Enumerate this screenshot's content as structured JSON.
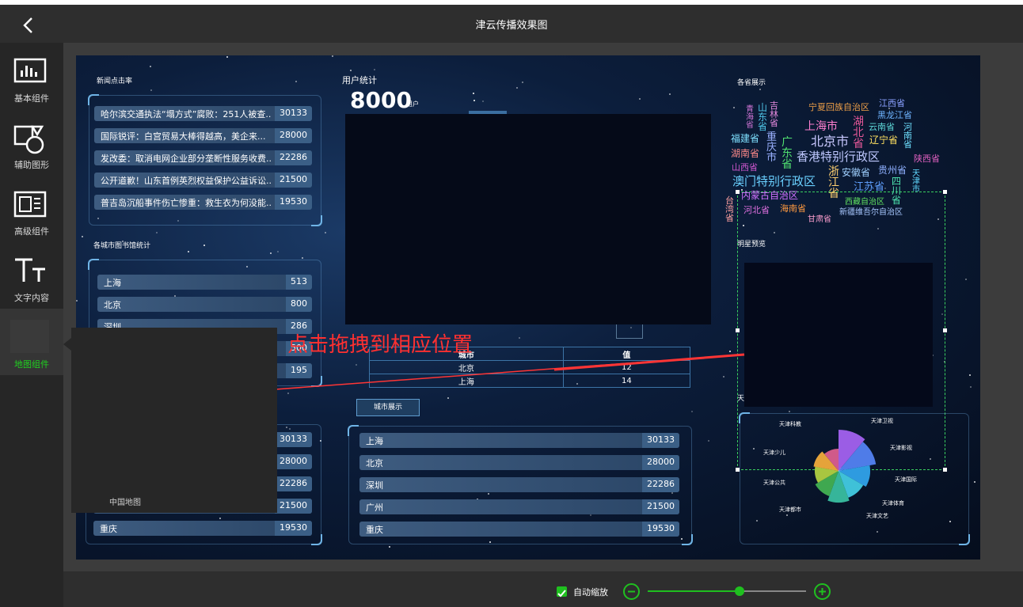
{
  "app": {
    "title": "津云传播效果图"
  },
  "sidebar": {
    "items": [
      {
        "label": "基本组件",
        "icon": "bar-chart-icon"
      },
      {
        "label": "辅助图形",
        "icon": "shapes-icon"
      },
      {
        "label": "高级组件",
        "icon": "layout-icon"
      },
      {
        "label": "文字内容",
        "icon": "text-icon"
      },
      {
        "label": "地图组件",
        "icon": "map-icon"
      }
    ]
  },
  "flyout": {
    "item_label": "中国地图"
  },
  "hint": {
    "text": "点击拖拽到相应位置"
  },
  "bottom": {
    "auto_zoom_label": "自动缩放",
    "zoom_level": 0.58
  },
  "canvas": {
    "news": {
      "title": "新闻点击率",
      "items": [
        {
          "name": "哈尔滨交通执法“塌方式”腐败：251人被查...",
          "value": "30133"
        },
        {
          "name": "国际锐评：白宫贸易大棒得越高，美企来...",
          "value": "28000"
        },
        {
          "name": "发改委：取消电网企业部分垄断性服务收费...",
          "value": "22286"
        },
        {
          "name": "公开道歉！山东首例英烈权益保护公益诉讼...",
          "value": "21500"
        },
        {
          "name": "普吉岛沉船事件伤亡惨重：救生衣为何没能...",
          "value": "19530"
        }
      ]
    },
    "library": {
      "title": "各城市图书馆统计",
      "items": [
        {
          "name": "上海",
          "value": "513"
        },
        {
          "name": "北京",
          "value": "800"
        },
        {
          "name": "深圳",
          "value": "286"
        },
        {
          "name": "",
          "value": "500"
        },
        {
          "name": "",
          "value": "195"
        }
      ]
    },
    "bottom_left": {
      "items": [
        {
          "name": "",
          "value": "30133"
        },
        {
          "name": "",
          "value": "28000"
        },
        {
          "name": "",
          "value": "22286"
        },
        {
          "name": "",
          "value": "21500"
        },
        {
          "name": "重庆",
          "value": "19530"
        }
      ]
    },
    "users": {
      "title": "用户统计",
      "count": "8000",
      "unit": "用户"
    },
    "city_table": {
      "headers": [
        "城市",
        "值"
      ],
      "rows": [
        [
          "北京",
          "12"
        ],
        [
          "上海",
          "14"
        ]
      ]
    },
    "city_show": {
      "button_label": "城市展示",
      "items": [
        {
          "name": "上海",
          "value": "30133"
        },
        {
          "name": "北京",
          "value": "28000"
        },
        {
          "name": "深圳",
          "value": "22286"
        },
        {
          "name": "广州",
          "value": "21500"
        },
        {
          "name": "重庆",
          "value": "19530"
        }
      ]
    },
    "provinces": {
      "title": "各省展示"
    },
    "celebrity": {
      "title": "明星预览"
    },
    "tianjin_label": "天",
    "rose": {
      "labels": [
        "天津科教",
        "天津卫视",
        "天津影视",
        "天津少儿",
        "天津国际",
        "天津公共",
        "天津体育",
        "天津都市",
        "天津文艺"
      ]
    }
  },
  "wordcloud": [
    {
      "t": "青海省",
      "c": "#d276d8"
    },
    {
      "t": "吉林省",
      "c": "#e58adf"
    },
    {
      "t": "山东省",
      "c": "#4fc6e8"
    },
    {
      "t": "宁夏回族自治区",
      "c": "#f0a048"
    },
    {
      "t": "江西省",
      "c": "#8aa0ff"
    },
    {
      "t": "湖北省",
      "c": "#e8589a"
    },
    {
      "t": "黑龙江省",
      "c": "#6fb4ff"
    },
    {
      "t": "上海市",
      "c": "#ff7fd0"
    },
    {
      "t": "河南省",
      "c": "#6ee0ff"
    },
    {
      "t": "云南省",
      "c": "#5ed8d8"
    },
    {
      "t": "北京市",
      "c": "#c8c8ff"
    },
    {
      "t": "辽宁省",
      "c": "#ffe060"
    },
    {
      "t": "福建省",
      "c": "#7fe0ff"
    },
    {
      "t": "重庆市",
      "c": "#9ab0ff"
    },
    {
      "t": "广东省",
      "c": "#50e070"
    },
    {
      "t": "湖南省",
      "c": "#ff8a8a"
    },
    {
      "t": "香港特别行政区",
      "c": "#bfc8ff"
    },
    {
      "t": "陕西省",
      "c": "#e060c0"
    },
    {
      "t": "山西省",
      "c": "#d058d0"
    },
    {
      "t": "浙江省",
      "c": "#ffd070"
    },
    {
      "t": "安徽省",
      "c": "#a0d0ff"
    },
    {
      "t": "贵州省",
      "c": "#8fb0ff"
    },
    {
      "t": "天津市",
      "c": "#60d8ff"
    },
    {
      "t": "澳门特别行政区",
      "c": "#6ad0ff"
    },
    {
      "t": "江苏省",
      "c": "#60a0ff"
    },
    {
      "t": "四川省",
      "c": "#4fe6b0"
    },
    {
      "t": "内蒙古自治区",
      "c": "#d070ff"
    },
    {
      "t": "台湾省",
      "c": "#ffa0a0"
    },
    {
      "t": "河北省",
      "c": "#e070e0"
    },
    {
      "t": "海南省",
      "c": "#ff9a40"
    },
    {
      "t": "西藏自治区",
      "c": "#60e060"
    },
    {
      "t": "甘肃省",
      "c": "#ffa0d0"
    },
    {
      "t": "新疆维吾尔自治区",
      "c": "#a8c8ff"
    }
  ]
}
